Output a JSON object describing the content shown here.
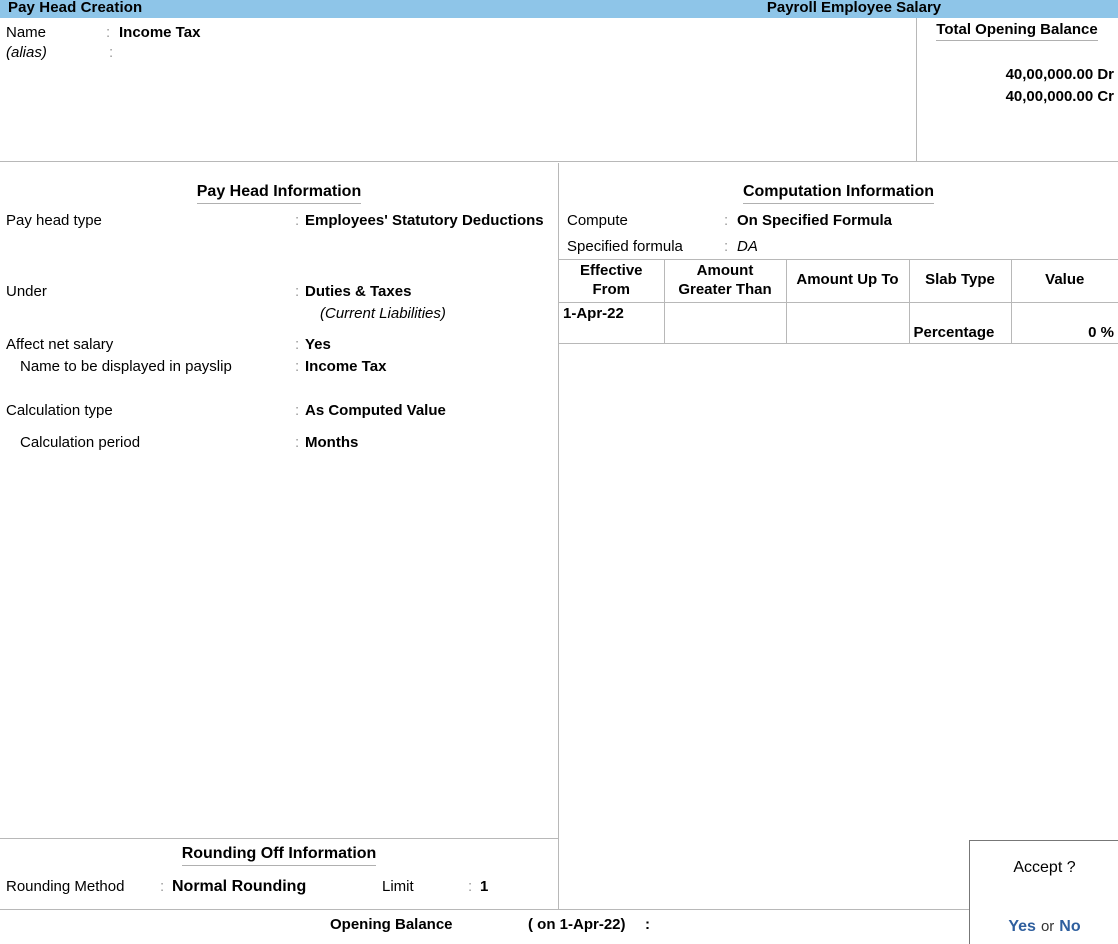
{
  "titlebar": {
    "left_title": "Pay Head  Creation",
    "right_title": "Payroll Employee Salary",
    "bg_color": "#8ec5e8"
  },
  "header": {
    "name_label": "Name",
    "name_colon": ":",
    "name_value": "Income Tax",
    "alias_label": "(alias)",
    "alias_colon": ":",
    "alias_value": "",
    "total_opening_balance": {
      "title": "Total Opening Balance",
      "debit": "40,00,000.00 Dr",
      "credit": "40,00,000.00 Cr"
    }
  },
  "pay_head_information": {
    "title": "Pay Head Information",
    "rows": [
      {
        "label": "Pay head type",
        "colon": ":",
        "value": "Employees' Statutory Deductions"
      },
      {
        "label": "Under",
        "colon": ":",
        "value": "Duties & Taxes"
      },
      {
        "label": "",
        "colon": "",
        "value": "(Current Liabilities)"
      },
      {
        "label": "Affect net salary",
        "colon": ":",
        "value": "Yes"
      },
      {
        "label": "Name to be displayed in payslip",
        "colon": ":",
        "value": "Income Tax"
      },
      {
        "label": "Calculation type",
        "colon": ":",
        "value": "As Computed Value"
      },
      {
        "label": "Calculation period",
        "colon": ":",
        "value": "Months"
      }
    ]
  },
  "computation_information": {
    "title": "Computation Information",
    "compute_label": "Compute",
    "compute_colon": ":",
    "compute_value": "On Specified Formula",
    "formula_label": "Specified formula",
    "formula_colon": ":",
    "formula_value": "DA",
    "slab_table": {
      "headers": [
        "Effective From",
        "Amount Greater Than",
        "Amount Up To",
        "Slab Type",
        "Value"
      ],
      "headers_split": [
        [
          "Effective",
          "From"
        ],
        [
          "Amount",
          "Greater Than"
        ],
        [
          "Amount Up To",
          ""
        ],
        [
          "Slab Type",
          ""
        ],
        [
          "Value",
          ""
        ]
      ],
      "rows": [
        {
          "effective_from": "1-Apr-22",
          "amount_greater_than": "",
          "amount_up_to": "",
          "slab_type": "Percentage",
          "value": "0 %"
        }
      ]
    }
  },
  "rounding_off_information": {
    "title": "Rounding Off Information",
    "method_label": "Rounding Method",
    "method_colon": ":",
    "method_value": "Normal Rounding",
    "limit_label": "Limit",
    "limit_colon": ":",
    "limit_value": "1"
  },
  "footer": {
    "opening_balance_label": "Opening Balance",
    "opening_balance_on": "( on 1-Apr-22)",
    "opening_balance_colon": ":",
    "opening_balance_value": ""
  },
  "accept_dialog": {
    "title": "Accept ?",
    "yes_label": "Yes",
    "or_label": "or",
    "no_label": "No",
    "link_color": "#2f5f9e"
  }
}
